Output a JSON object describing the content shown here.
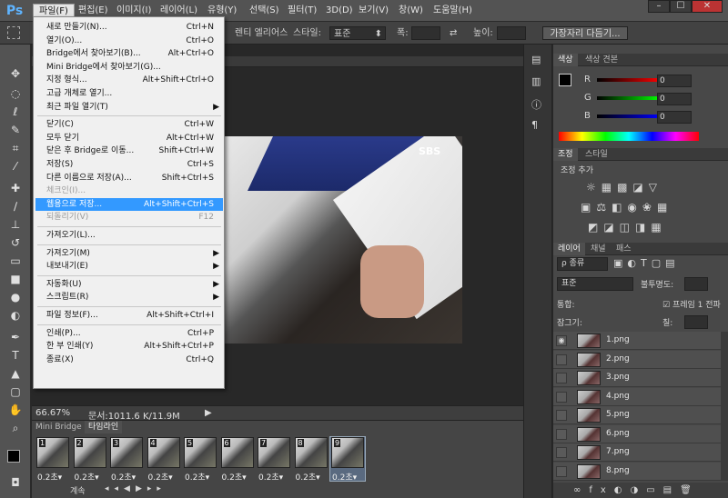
{
  "menubar": {
    "logo": "Ps",
    "items": [
      "파일(F)",
      "편집(E)",
      "이미지(I)",
      "레이어(L)",
      "유형(Y)",
      "선택(S)",
      "필터(T)",
      "3D(D)",
      "보기(V)",
      "창(W)",
      "도움말(H)"
    ],
    "window_buttons": [
      "–",
      "☐",
      "✕"
    ]
  },
  "options": {
    "refine_text": "렌티 엘리어스",
    "style_label": "스타일:",
    "style_value": "표준",
    "width_label": "폭:",
    "height_label": "높이:",
    "refine_button": "가장자리 다듬기..."
  },
  "dropdown": {
    "items": [
      {
        "label": "새로 만들기(N)...",
        "shortcut": "Ctrl+N",
        "state": "normal"
      },
      {
        "label": "열기(O)...",
        "shortcut": "Ctrl+O",
        "state": "normal"
      },
      {
        "label": "Bridge에서 찾아보기(B)...",
        "shortcut": "Alt+Ctrl+O",
        "state": "normal"
      },
      {
        "label": "Mini Bridge에서 찾아보기(G)...",
        "shortcut": "",
        "state": "normal"
      },
      {
        "label": "지정 형식...",
        "shortcut": "Alt+Shift+Ctrl+O",
        "state": "normal"
      },
      {
        "label": "고급 개체로 열기...",
        "shortcut": "",
        "state": "normal"
      },
      {
        "label": "최근 파일 열기(T)",
        "shortcut": "",
        "state": "submenu"
      },
      {
        "label": "닫기(C)",
        "shortcut": "Ctrl+W",
        "state": "normal"
      },
      {
        "label": "모두 닫기",
        "shortcut": "Alt+Ctrl+W",
        "state": "normal"
      },
      {
        "label": "닫은 후 Bridge로 이동...",
        "shortcut": "Shift+Ctrl+W",
        "state": "normal"
      },
      {
        "label": "저장(S)",
        "shortcut": "Ctrl+S",
        "state": "normal"
      },
      {
        "label": "다른 이름으로 저장(A)...",
        "shortcut": "Shift+Ctrl+S",
        "state": "normal"
      },
      {
        "label": "체크인(I)...",
        "shortcut": "",
        "state": "disabled"
      },
      {
        "label": "웹용으로 저장...",
        "shortcut": "Alt+Shift+Ctrl+S",
        "state": "highlighted"
      },
      {
        "label": "되돌리기(V)",
        "shortcut": "F12",
        "state": "disabled"
      },
      {
        "label": "가져오기(L)...",
        "shortcut": "",
        "state": "normal"
      },
      {
        "label": "가져오기(M)",
        "shortcut": "",
        "state": "submenu"
      },
      {
        "label": "내보내기(E)",
        "shortcut": "",
        "state": "submenu"
      },
      {
        "label": "자동화(U)",
        "shortcut": "",
        "state": "submenu"
      },
      {
        "label": "스크립트(R)",
        "shortcut": "",
        "state": "submenu"
      },
      {
        "label": "파일 정보(F)...",
        "shortcut": "Alt+Shift+Ctrl+I",
        "state": "normal"
      },
      {
        "label": "인쇄(P)...",
        "shortcut": "Ctrl+P",
        "state": "normal"
      },
      {
        "label": "한 부 인쇄(Y)",
        "shortcut": "Alt+Shift+Ctrl+P",
        "state": "normal"
      },
      {
        "label": "종료(X)",
        "shortcut": "Ctrl+Q",
        "state": "normal"
      }
    ],
    "arrow": "▶"
  },
  "canvas": {
    "watermark": "SBS",
    "status_zoom": "66.67%",
    "status_doc": "문서:1011.6 K/11.9M"
  },
  "timeline": {
    "tabs": [
      "Mini Bridge",
      "타임라인"
    ],
    "frames": [
      {
        "num": "1",
        "dur": "0.2초▾"
      },
      {
        "num": "2",
        "dur": "0.2초▾"
      },
      {
        "num": "3",
        "dur": "0.2초▾"
      },
      {
        "num": "4",
        "dur": "0.2초▾"
      },
      {
        "num": "5",
        "dur": "0.2초▾"
      },
      {
        "num": "6",
        "dur": "0.2초▾"
      },
      {
        "num": "7",
        "dur": "0.2초▾"
      },
      {
        "num": "8",
        "dur": "0.2초▾"
      },
      {
        "num": "9",
        "dur": "0.2초▾"
      }
    ],
    "loop": "계속",
    "selected_frame": 9
  },
  "color_panel": {
    "tabs": [
      "색상",
      "색상 견본"
    ],
    "labels": [
      "R",
      "G",
      "B"
    ],
    "values": [
      "0",
      "0",
      "0"
    ]
  },
  "adjust_panel": {
    "tabs": [
      "조정",
      "스타일"
    ],
    "title": "조정 추가"
  },
  "layers_panel": {
    "tabs": [
      "레이어",
      "채널",
      "패스"
    ],
    "filter": "ρ 종류",
    "blend": "표준",
    "opacity_label": "불투명도:",
    "unify_label": "통합:",
    "propagate": "프레임 1 전파",
    "lock_label": "잠그기:",
    "fill_label": "칠:",
    "layers": [
      "1.png",
      "2.png",
      "3.png",
      "4.png",
      "5.png",
      "6.png",
      "7.png",
      "8.png"
    ]
  },
  "colors": {
    "menu_highlight": "#3399ff",
    "ps_blue": "#5fb4ff"
  }
}
